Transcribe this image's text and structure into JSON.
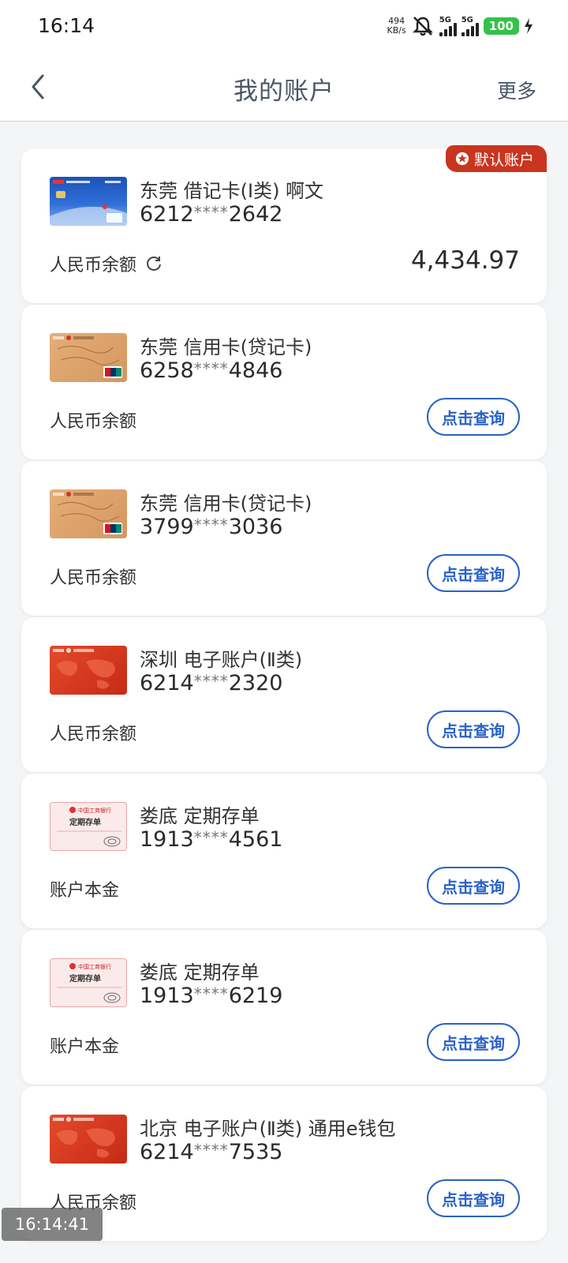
{
  "status_bar": {
    "time": "16:14",
    "net_speed_value": "494",
    "net_speed_unit": "KB/s",
    "signal1_label": "5G",
    "signal2_label": "5G",
    "battery": "100"
  },
  "header": {
    "title": "我的账户",
    "more_label": "更多"
  },
  "accounts": [
    {
      "name": "东莞 借记卡(Ⅰ类) 啊文",
      "number_prefix": "6212",
      "number_mask": "****",
      "number_suffix": "2642",
      "balance_label": "人民币余额",
      "balance": "4,434.97",
      "badge": "默认账户",
      "card_art": "debit-card-blue"
    },
    {
      "name": "东莞 信用卡(贷记卡)",
      "number_prefix": "6258",
      "number_mask": "****",
      "number_suffix": "4846",
      "balance_label": "人民币余额",
      "query_label": "点击查询",
      "card_art": "credit-card-gold"
    },
    {
      "name": "东莞 信用卡(贷记卡)",
      "number_prefix": "3799",
      "number_mask": "****",
      "number_suffix": "3036",
      "balance_label": "人民币余额",
      "query_label": "点击查询",
      "card_art": "credit-card-gold"
    },
    {
      "name": "深圳 电子账户(Ⅱ类)",
      "number_prefix": "6214",
      "number_mask": "****",
      "number_suffix": "2320",
      "balance_label": "人民币余额",
      "query_label": "点击查询",
      "card_art": "e-account-red"
    },
    {
      "name": "娄底 定期存单",
      "number_prefix": "1913",
      "number_mask": "****",
      "number_suffix": "4561",
      "balance_label": "账户本金",
      "query_label": "点击查询",
      "card_art": "deposit-certificate",
      "art_bank_text": "中国工商银行",
      "art_title": "定期存单"
    },
    {
      "name": "娄底 定期存单",
      "number_prefix": "1913",
      "number_mask": "****",
      "number_suffix": "6219",
      "balance_label": "账户本金",
      "query_label": "点击查询",
      "card_art": "deposit-certificate",
      "art_bank_text": "中国工商银行",
      "art_title": "定期存单"
    },
    {
      "name": "北京 电子账户(Ⅱ类) 通用e钱包",
      "number_prefix": "6214",
      "number_mask": "****",
      "number_suffix": "7535",
      "balance_label": "人民币余额",
      "query_label": "点击查询",
      "card_art": "e-account-red"
    }
  ],
  "overlay": {
    "timestamp": "16:14:41"
  },
  "colors": {
    "accent_blue": "#2962c7",
    "badge_red": "#c9351f",
    "battery_green": "#34c24a",
    "background": "#f4f5f7"
  }
}
